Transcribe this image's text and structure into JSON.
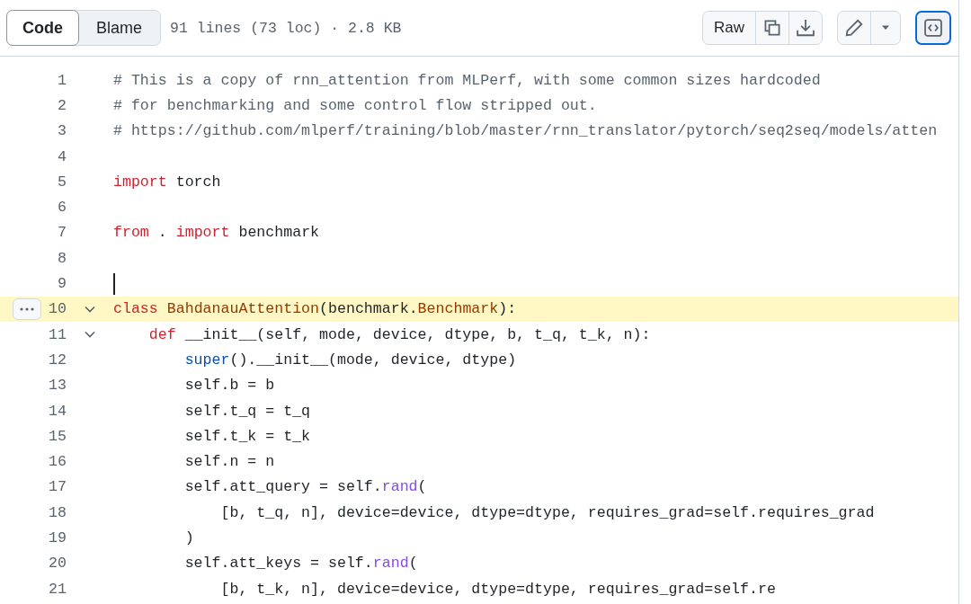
{
  "toolbar": {
    "tabs": [
      {
        "label": "Code",
        "selected": true
      },
      {
        "label": "Blame",
        "selected": false
      }
    ],
    "file_info": "91 lines (73 loc) · 2.8 KB",
    "raw_button": "Raw"
  },
  "code": {
    "lines": [
      {
        "number": "1",
        "selected": false,
        "tokens": [
          {
            "kind": "comment",
            "text": "# This is a copy of rnn_attention from MLPerf, with some common sizes hardcoded"
          }
        ]
      },
      {
        "number": "2",
        "selected": false,
        "tokens": [
          {
            "kind": "comment",
            "text": "# for benchmarking and some control flow stripped out."
          }
        ]
      },
      {
        "number": "3",
        "selected": false,
        "tokens": [
          {
            "kind": "comment",
            "text": "# https://github.com/mlperf/training/blob/master/rnn_translator/pytorch/seq2seq/models/atten"
          }
        ]
      },
      {
        "number": "4",
        "selected": false
      },
      {
        "number": "5",
        "selected": false,
        "tokens": [
          {
            "kind": "keyword",
            "text": "import"
          },
          {
            "kind": "plain",
            "text": " torch"
          }
        ]
      },
      {
        "number": "6",
        "selected": false
      },
      {
        "number": "7",
        "selected": false,
        "tokens": [
          {
            "kind": "keyword",
            "text": "from"
          },
          {
            "kind": "plain",
            "text": " . "
          },
          {
            "kind": "keyword",
            "text": "import"
          },
          {
            "kind": "plain",
            "text": " benchmark"
          }
        ]
      },
      {
        "number": "8",
        "selected": false
      },
      {
        "number": "9",
        "selected": false,
        "cursor": true
      },
      {
        "number": "10",
        "selected": true,
        "expanded": true,
        "tokens": [
          {
            "kind": "keyword",
            "text": "class"
          },
          {
            "kind": "class",
            "text": " BahdanauAttention"
          },
          {
            "kind": "plain",
            "text": "(benchmark."
          },
          {
            "kind": "class",
            "text": "Benchmark"
          },
          {
            "kind": "plain",
            "text": "):"
          }
        ]
      },
      {
        "number": "11",
        "selected": false,
        "expanded": true,
        "tokens": [
          {
            "kind": "keyword",
            "text": "    def"
          },
          {
            "kind": "plain",
            "text": " __init__(self, mode, device, dtype, b, t_q, t_k, n):"
          }
        ]
      },
      {
        "number": "12",
        "selected": false,
        "tokens": [
          {
            "kind": "builtin",
            "text": "        super"
          },
          {
            "kind": "plain",
            "text": "().__init__(mode, device, dtype)"
          }
        ]
      },
      {
        "number": "13",
        "selected": false,
        "tokens": [
          {
            "kind": "plain",
            "text": "        self.b = b"
          }
        ]
      },
      {
        "number": "14",
        "selected": false,
        "tokens": [
          {
            "kind": "plain",
            "text": "        self.t_q = t_q"
          }
        ]
      },
      {
        "number": "15",
        "selected": false,
        "tokens": [
          {
            "kind": "plain",
            "text": "        self.t_k = t_k"
          }
        ]
      },
      {
        "number": "16",
        "selected": false,
        "tokens": [
          {
            "kind": "plain",
            "text": "        self.n = n"
          }
        ]
      },
      {
        "number": "17",
        "selected": false,
        "tokens": [
          {
            "kind": "plain",
            "text": "        self.att_query = self."
          },
          {
            "kind": "function",
            "text": "rand"
          },
          {
            "kind": "plain",
            "text": "("
          }
        ]
      },
      {
        "number": "18",
        "selected": false,
        "tokens": [
          {
            "kind": "plain",
            "text": "            [b, t_q, n], device=device, dtype=dtype, requires_grad=self.requires_grad"
          }
        ]
      },
      {
        "number": "19",
        "selected": false,
        "tokens": [
          {
            "kind": "plain",
            "text": "        )"
          }
        ]
      },
      {
        "number": "20",
        "selected": false,
        "tokens": [
          {
            "kind": "plain",
            "text": "        self.att_keys = self."
          },
          {
            "kind": "function",
            "text": "rand"
          },
          {
            "kind": "plain",
            "text": "("
          }
        ]
      },
      {
        "number": "21",
        "selected": false,
        "tokens": [
          {
            "kind": "plain",
            "text": "            [b, t_k, n], device=device, dtype=dtype, requires_grad=self.re"
          }
        ]
      }
    ]
  }
}
